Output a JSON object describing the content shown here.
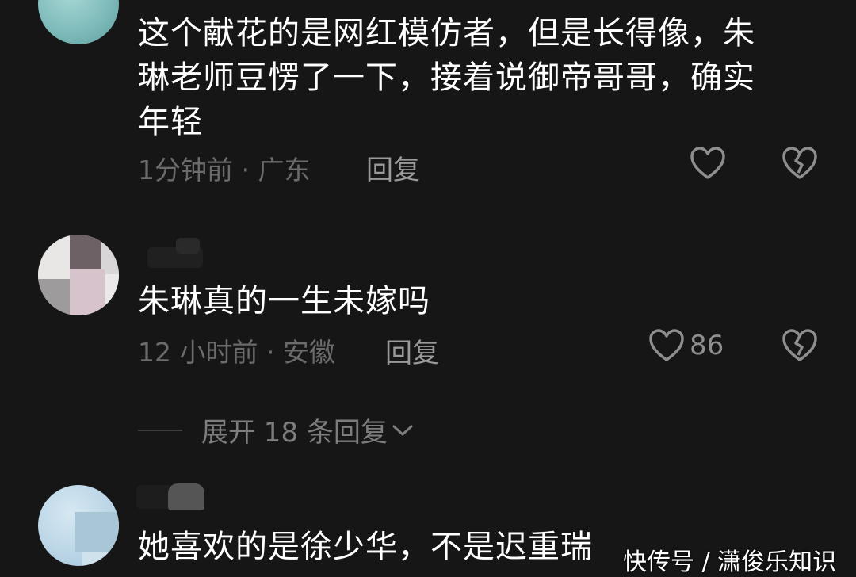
{
  "comments": [
    {
      "text_lines": [
        "这个献花的是网红模仿者，但是长得像，朱",
        "琳老师豆愣了一下，接着说御帝哥哥，确实",
        "年轻"
      ],
      "meta": "1分钟前 · 广东",
      "reply_label": "回复",
      "likes": ""
    },
    {
      "text_lines": [
        "朱琳真的一生未嫁吗"
      ],
      "meta": "12 小时前 · 安徽",
      "reply_label": "回复",
      "likes": "86"
    },
    {
      "text_lines": [
        "她喜欢的是徐少华，不是迟重瑞"
      ]
    }
  ],
  "expand_replies": "展开 18 条回复",
  "watermark": "快传号 / 潇俊乐知识",
  "colors": {
    "background": "#161616",
    "text": "#ffffff",
    "meta": "#6b6b6b",
    "icon": "#8e8e8e"
  },
  "icons": [
    "heart-outline-icon",
    "broken-heart-icon",
    "chevron-down-icon"
  ]
}
